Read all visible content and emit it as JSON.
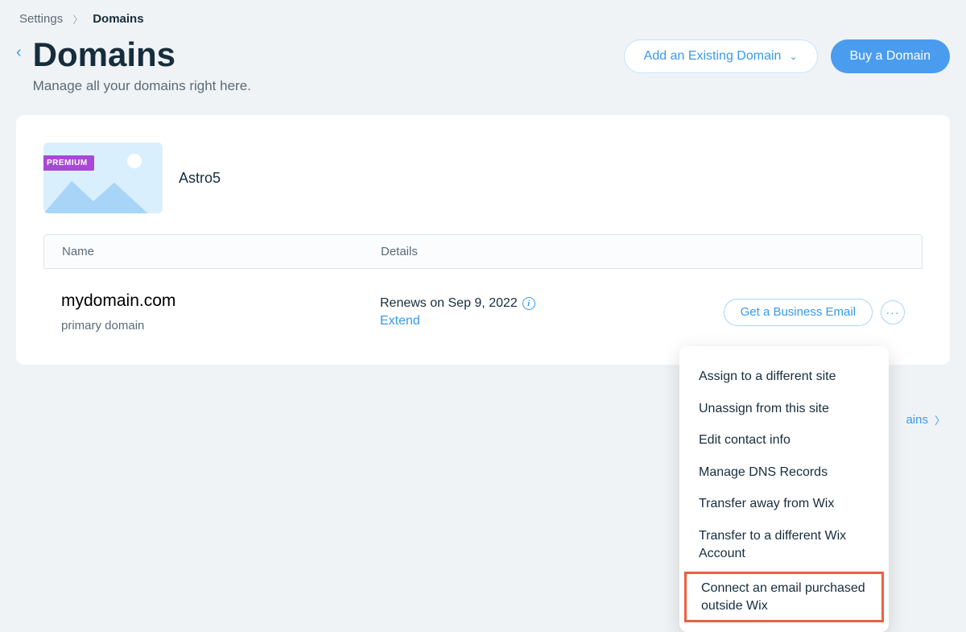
{
  "breadcrumb": {
    "parent": "Settings",
    "current": "Domains"
  },
  "header": {
    "title": "Domains",
    "subtitle": "Manage all your domains right here.",
    "add_button": "Add an Existing Domain",
    "buy_button": "Buy a Domain"
  },
  "site": {
    "badge": "PREMIUM",
    "name": "Astro5"
  },
  "table": {
    "columns": {
      "name": "Name",
      "details": "Details"
    },
    "row": {
      "domain": "mydomain.com",
      "subtext": "primary domain",
      "renews": "Renews on Sep 9, 2022",
      "extend": "Extend",
      "email_button": "Get a Business Email"
    }
  },
  "footer_link": "ains",
  "menu": {
    "items": [
      "Assign to a different site",
      "Unassign from this site",
      "Edit contact info",
      "Manage DNS Records",
      "Transfer away from Wix",
      "Transfer to a different Wix Account",
      "Connect an email purchased outside Wix"
    ]
  }
}
